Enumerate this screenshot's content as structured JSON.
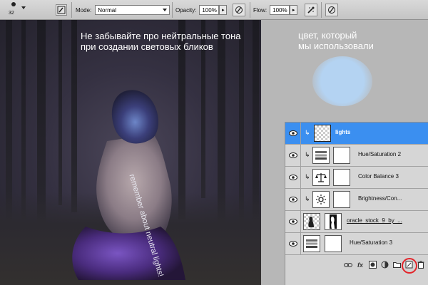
{
  "toolbar": {
    "brush_size": "32",
    "mode_label": "Mode:",
    "mode_value": "Normal",
    "opacity_label": "Opacity:",
    "opacity_value": "100%",
    "flow_label": "Flow:",
    "flow_value": "100%"
  },
  "canvas": {
    "caption_line1": "Не забывайте про нейтральные тона",
    "caption_line2": "при создании световых бликов",
    "vertical_text": "remember about neutral lights!"
  },
  "side": {
    "note_line1": "цвет, который",
    "note_line2": "мы использовали",
    "swatch_color": "#b4d3f2"
  },
  "layers": {
    "items": [
      {
        "name": "lights",
        "selected": true
      },
      {
        "name": "Hue/Saturation 2",
        "selected": false
      },
      {
        "name": "Color Balance 3",
        "selected": false
      },
      {
        "name": "Brightness/Con...",
        "selected": false
      },
      {
        "name": "oracle_stock_9_by_...",
        "selected": false
      },
      {
        "name": "Hue/Saturation 3",
        "selected": false
      }
    ],
    "selection_color": "#3b8ff0"
  }
}
